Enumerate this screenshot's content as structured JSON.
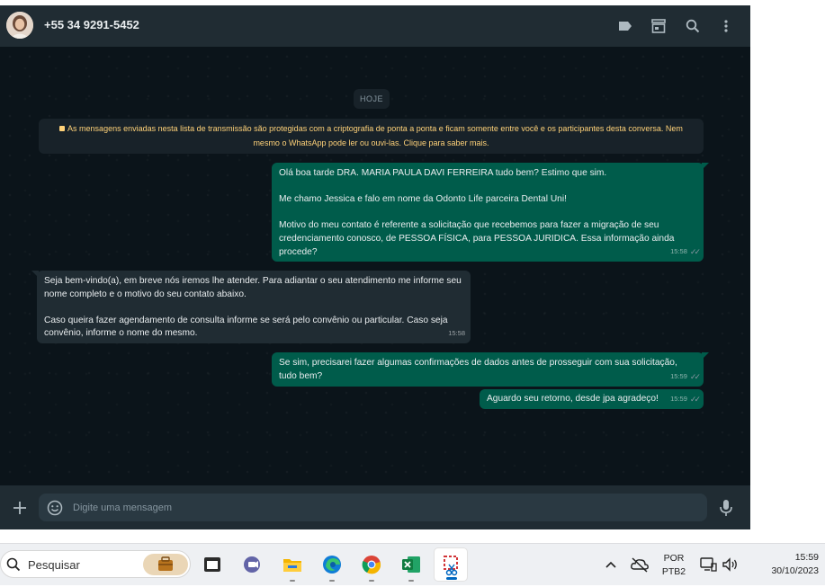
{
  "header": {
    "contact_name": "+55 34 9291-5452",
    "icons": [
      "label-icon",
      "store-icon",
      "search-icon",
      "menu-icon"
    ]
  },
  "chat": {
    "date_chip": "HOJE",
    "encryption_notice_line1": "As mensagens enviadas nesta lista de transmissão são protegidas com a criptografia de ponta a ponta e ficam somente entre você e os participantes desta conversa. Nem",
    "encryption_notice_line2": "mesmo o WhatsApp pode ler ou ouvi-las. Clique para saber mais.",
    "messages": [
      {
        "direction": "out",
        "lines": [
          "Olá boa tarde DRA. MARIA PAULA DAVI FERREIRA tudo bem? Estimo que sim.",
          "Me chamo Jessica e falo em nome da Odonto Life parceira Dental Uni!",
          "Motivo do meu contato é referente a solicitação que recebemos para fazer a migração de seu credenciamento conosco, de PESSOA FÍSICA, para PESSOA JURIDICA. Essa informação ainda procede?"
        ],
        "time": "15:58",
        "status": "delivered"
      },
      {
        "direction": "in",
        "lines": [
          "Seja bem-vindo(a), em breve nós iremos lhe atender. Para adiantar o seu atendimento me informe seu nome completo e o motivo do seu contato abaixo.",
          "Caso queira fazer agendamento de consulta informe se será pelo convênio ou particular. Caso seja convênio, informe o nome do mesmo."
        ],
        "time": "15:58"
      },
      {
        "direction": "out",
        "lines": [
          "Se sim, precisarei fazer algumas confirmações de dados antes de prosseguir com sua solicitação, tudo bem?"
        ],
        "time": "15:59",
        "status": "delivered"
      },
      {
        "direction": "out",
        "lines": [
          "Aguardo seu retorno, desde jpa agradeço!"
        ],
        "time": "15:59",
        "status": "delivered"
      }
    ]
  },
  "composer": {
    "placeholder": "Digite uma mensagem"
  },
  "taskbar": {
    "search_label": "Pesquisar",
    "apps": [
      "briefcase-icon",
      "terminal-icon",
      "teams-icon",
      "file-explorer-icon",
      "edge-icon",
      "chrome-icon",
      "excel-icon",
      "snipping-tool-icon"
    ],
    "language_top": "POR",
    "language_bottom": "PTB2",
    "clock_time": "15:59",
    "clock_date": "30/10/2023"
  },
  "colors": {
    "outgoing_bubble": "#005c4b",
    "incoming_bubble": "#202c33",
    "chat_background": "#0b141a",
    "notice_text": "#ffd279"
  }
}
